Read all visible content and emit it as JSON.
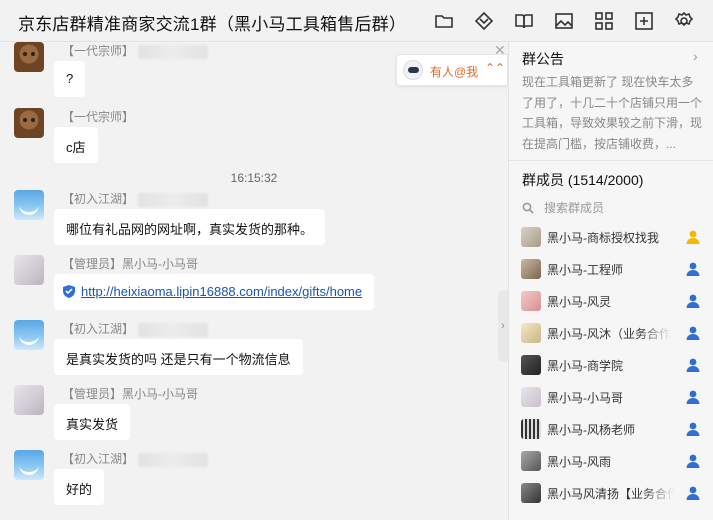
{
  "window": {
    "title": "京东店群精准商家交流1群（黑小马工具箱售后群）",
    "toolbar_icons": [
      "folder-icon",
      "app-icon",
      "book-icon",
      "image-icon",
      "grid-icon",
      "add-icon",
      "settings-icon"
    ]
  },
  "mention": {
    "text": "有人@我",
    "arrows": "⌃⌃"
  },
  "chat": {
    "timestamp": "16:15:32",
    "messages": [
      {
        "sender": "【一代宗师】",
        "text": "?",
        "avatar": "dog"
      },
      {
        "sender": "【一代宗师】",
        "text": "c店",
        "avatar": "dog"
      },
      {
        "sender": "【初入江湖】",
        "text": "哪位有礼品网的网址啊，真实发货的那种。",
        "avatar": "sky"
      },
      {
        "sender": "【管理员】黑小马-小马哥",
        "text": "http://heixiaoma.lipin16888.com/index/gifts/home",
        "avatar": "grey",
        "is_link": true
      },
      {
        "sender": "【初入江湖】",
        "text": "是真实发货的吗  还是只有一个物流信息",
        "avatar": "sky"
      },
      {
        "sender": "【管理员】黑小马-小马哥",
        "text": "真实发货",
        "avatar": "grey"
      },
      {
        "sender": "【初入江湖】",
        "text": "好的",
        "avatar": "sky"
      }
    ]
  },
  "sidebar": {
    "notice_title": "群公告",
    "notice_text": "现在工具箱更新了 现在快车太多了用了，十几二十个店铺只用一个工具箱，导致效果较之前下滑，现在提高门槛，按店铺收费，...",
    "members_title": "群成员 (1514/2000)",
    "search_placeholder": "搜索群成员",
    "members": [
      {
        "name": "黑小马-商标授权找我",
        "role": "owner"
      },
      {
        "name": "黑小马-工程师",
        "role": "admin"
      },
      {
        "name": "黑小马-风灵",
        "role": "admin"
      },
      {
        "name": "黑小马-风沐（业务合作",
        "role": "admin"
      },
      {
        "name": "黑小马-商学院",
        "role": "admin"
      },
      {
        "name": "黑小马-小马哥",
        "role": "admin"
      },
      {
        "name": "黑小马-风杨老师",
        "role": "admin"
      },
      {
        "name": "黑小马-风雨",
        "role": "admin"
      },
      {
        "name": "黑小马风清扬【业务合作",
        "role": "admin"
      }
    ],
    "colors": {
      "owner": "#f5b800",
      "admin": "#2f6fd6",
      "mention": "#e06a2c",
      "link": "#1a56b0"
    }
  }
}
